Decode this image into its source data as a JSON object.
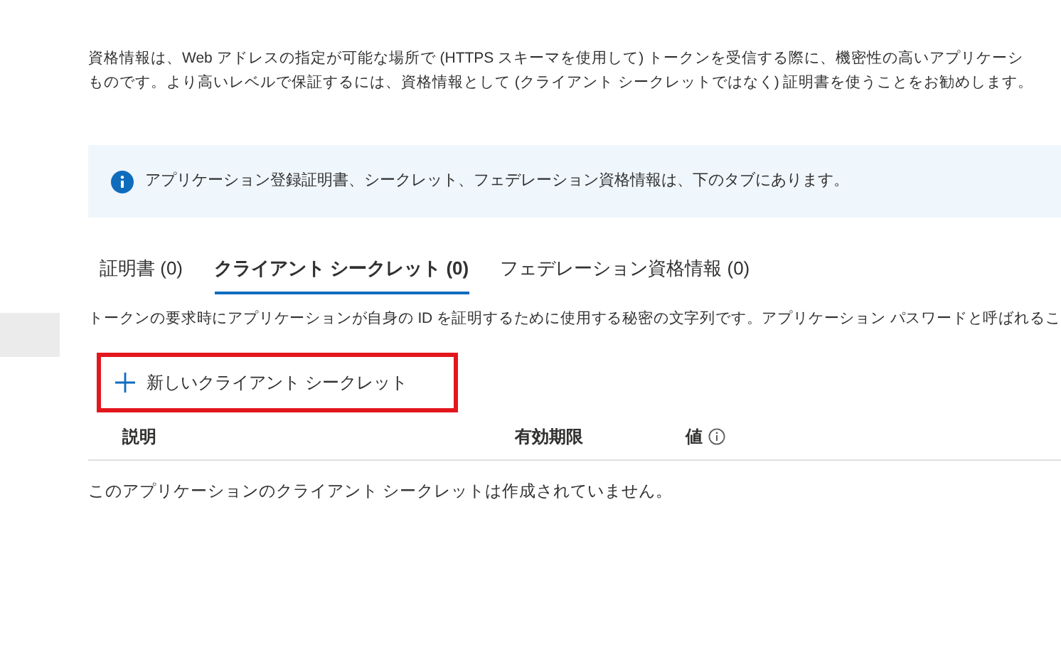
{
  "description": {
    "lines": [
      "資格情報は、Web アドレスの指定が可能な場所で (HTTPS スキーマを使用して) トークンを受信する際に、機密性の高いアプリケーシ",
      "ものです。より高いレベルで保証するには、資格情報として (クライアント シークレットではなく) 証明書を使うことをお勧めします。"
    ]
  },
  "info_banner": {
    "text": "アプリケーション登録証明書、シークレット、フェデレーション資格情報は、下のタブにあります。"
  },
  "tabs": [
    {
      "label": "証明書 (0)",
      "selected": false
    },
    {
      "label": "クライアント シークレット (0)",
      "selected": true
    },
    {
      "label": "フェデレーション資格情報 (0)",
      "selected": false
    }
  ],
  "tab_description": "トークンの要求時にアプリケーションが自身の ID を証明するために使用する秘密の文字列です。アプリケーション パスワードと呼ばれるこ",
  "new_button": {
    "label": "新しいクライアント シークレット",
    "highlighted": true
  },
  "table": {
    "columns": [
      {
        "label": "説明",
        "info": false
      },
      {
        "label": "有効期限",
        "info": false
      },
      {
        "label": "値",
        "info": true
      }
    ],
    "empty_message": "このアプリケーションのクライアント シークレットは作成されていません。"
  }
}
